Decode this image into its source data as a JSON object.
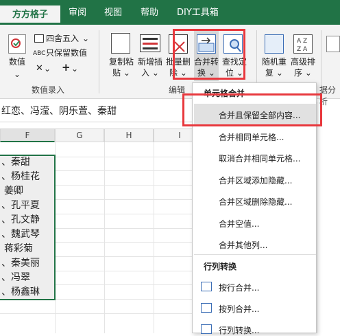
{
  "tabs": [
    "方方格子",
    "审阅",
    "视图",
    "帮助",
    "DIY工具箱"
  ],
  "ribbon": {
    "numeric": "数值",
    "round": "四舍五入",
    "keep_numeric": "只保留数值",
    "group_entry": "数值录入",
    "copy_paste": [
      "复制粘",
      "贴"
    ],
    "add_insert": [
      "新增插",
      "入"
    ],
    "batch_delete": [
      "批量删",
      "除"
    ],
    "merge_convert": [
      "合并转",
      "换"
    ],
    "find_locate": [
      "查找定",
      "位"
    ],
    "random_repeat": [
      "随机重",
      "复"
    ],
    "advanced_sort": [
      "高级排",
      "序"
    ],
    "group_edit": "编辑",
    "group_data_analysis": "据分析"
  },
  "formula_bar": "红恋、冯滢、阴乐萱、秦甜",
  "columns": [
    "F",
    "G",
    "H",
    "I"
  ],
  "cells": [
    "、秦甜",
    "、杨桂花",
    "姜卿",
    "、孔平夏",
    "、孔文静",
    "、魏武琴",
    "蒋彩菊",
    "、秦美丽",
    "、冯翠",
    "、杨鑫琳"
  ],
  "menu": {
    "header1": "单元格合并",
    "item_keep_all": "合并且保留全部内容...",
    "item_same": "合并相同单元格...",
    "item_unmerge": "取消合并相同单元格...",
    "item_add_hidden": "合并区域添加隐藏...",
    "item_del_hidden": "合并区域删除隐藏...",
    "item_blank": "合并空值...",
    "item_other": "合并其他列...",
    "header2": "行列转换",
    "item_row": "按行合并...",
    "item_col": "按列合并...",
    "item_convert": "行列转换..."
  },
  "colors": {
    "brand": "#217346",
    "highlight": "#e8383d"
  }
}
